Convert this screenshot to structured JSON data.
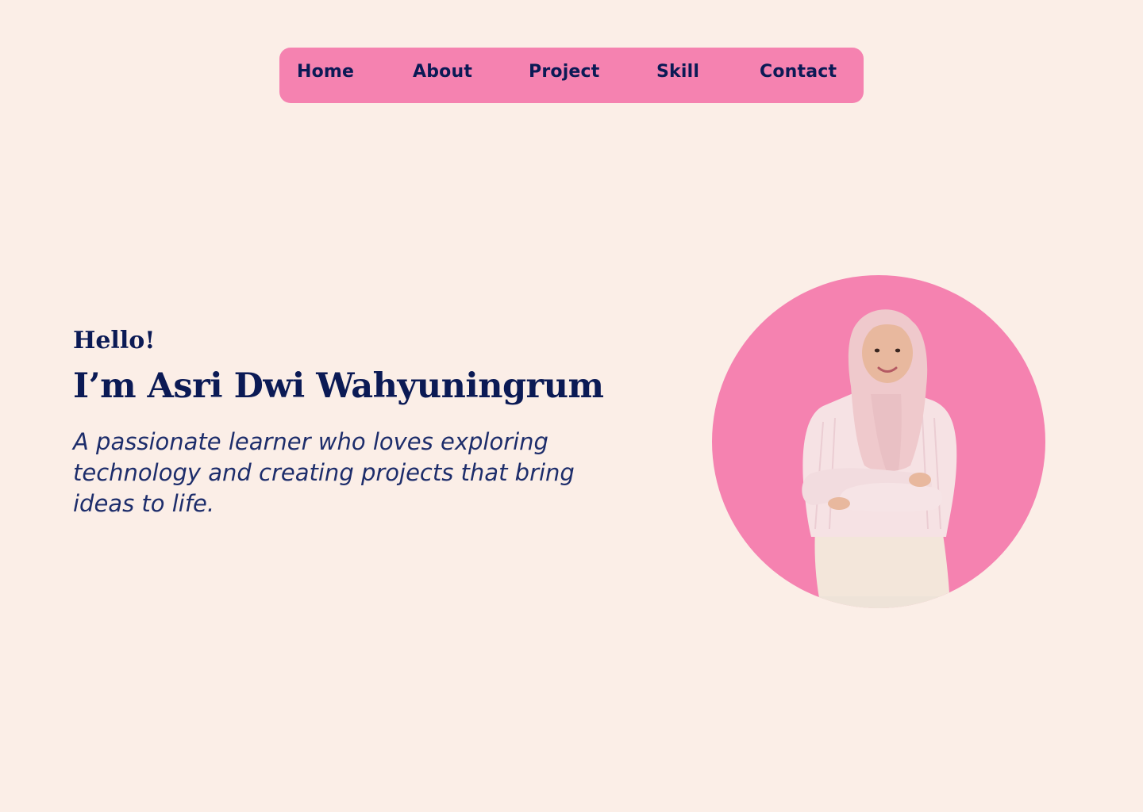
{
  "nav": {
    "items": [
      {
        "label": "Home"
      },
      {
        "label": "About"
      },
      {
        "label": "Project"
      },
      {
        "label": "Skill"
      },
      {
        "label": "Contact"
      }
    ]
  },
  "hero": {
    "greeting": "Hello!",
    "name": "I’m Asri Dwi Wahyuningrum",
    "tagline": "A passionate learner who loves exploring technology and creating projects that bring ideas to life."
  },
  "portrait": {
    "alt": "Portrait photo"
  },
  "colors": {
    "background": "#FBEEE7",
    "accent_pink": "#F582B0",
    "text_navy": "#0B1A55"
  }
}
